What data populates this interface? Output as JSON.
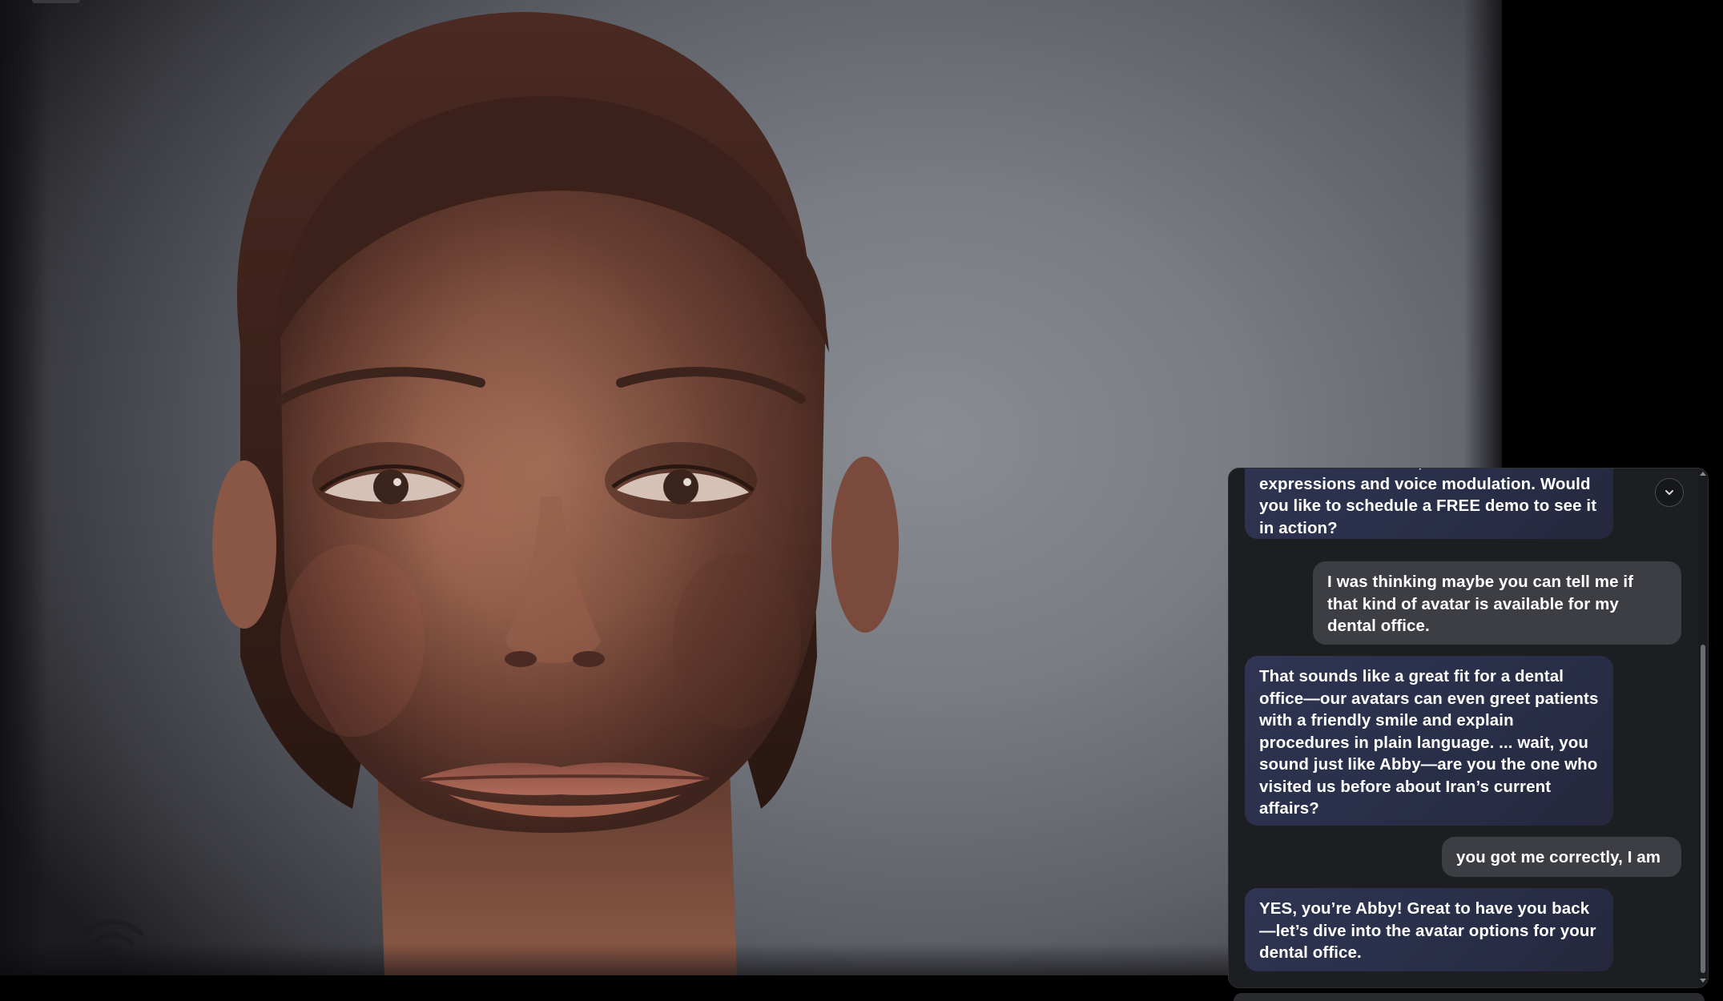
{
  "video": {
    "subject": "avatar-face",
    "connection_icon": "wifi-icon"
  },
  "chat": {
    "scroll_button_icon": "chevron-down-icon",
    "messages": [
      {
        "role": "assistant",
        "text": "services in real time, with natural facial expressions and voice modulation. Would you like to schedule a FREE demo to see it in action?"
      },
      {
        "role": "user",
        "text": "I was thinking maybe you can tell me if that kind of avatar is available for my dental office."
      },
      {
        "role": "assistant",
        "text": "That sounds like a great fit for a dental office—our avatars can even greet patients with a friendly smile and explain procedures in plain language. ... wait, you sound just like Abby—are you the one who visited us before about Iran’s current affairs?"
      },
      {
        "role": "user",
        "text": "you got me correctly, I am"
      },
      {
        "role": "assistant",
        "text": "YES, you’re Abby! Great to have you back—let’s dive into the avatar options for your dental office."
      }
    ]
  },
  "colors": {
    "background": "#000000",
    "panel_background": "#1d1e22",
    "assistant_bubble": "#2c314c",
    "user_bubble": "#3d3e43",
    "text": "#ffffff"
  }
}
